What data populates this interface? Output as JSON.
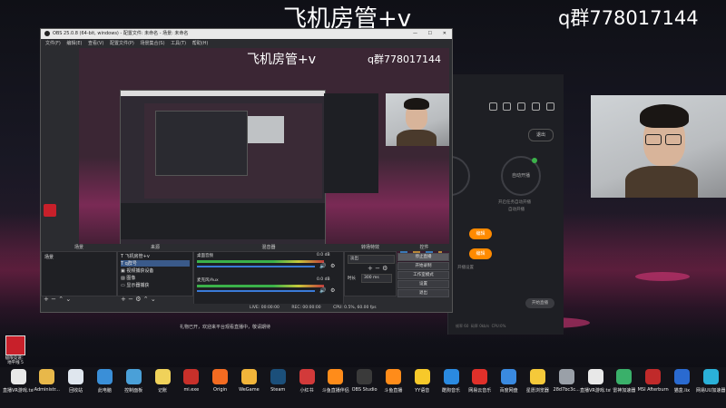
{
  "overlay": {
    "title_text": "飞机房管+v",
    "qq_text": "q群778017144"
  },
  "obs": {
    "window_title": "OBS 25.0.8 (64-bit, windows) - 配置文件: 未命名 - 场景: 未命名",
    "menu": [
      "文件(F)",
      "编辑(E)",
      "查看(V)",
      "配置文件(P)",
      "场景集合(S)",
      "工具(T)",
      "帮助(H)"
    ],
    "docks": {
      "scenes": "场景",
      "sources": "来源",
      "mixer": "混音器",
      "transitions": "转场特效",
      "controls": "控件"
    },
    "scenes": [
      "场景"
    ],
    "sources": [
      "飞机房管+v",
      "q群号",
      "视频捕获设备",
      "图像",
      "显示器捕获"
    ],
    "mixer": {
      "desktop_audio": "桌面音频",
      "desktop_db": "0.0 dB",
      "mic": "麦克风/Aux",
      "mic_db": "0.0 dB"
    },
    "transitions": {
      "type": "淡出",
      "duration_label": "时长",
      "duration_value": "300 ms"
    },
    "controls": [
      "停止直播",
      "开始录制",
      "工作室模式",
      "设置",
      "退出"
    ],
    "status": {
      "drops": "丢帧 0 (0.0%)",
      "live": "LIVE: 00:00:00",
      "rec": "REC: 00:00:00",
      "cpu": "CPU: 0.5%, 60.00 fps"
    },
    "notice": "礼物已开，欢迎来平台观看直播中，敬请期待"
  },
  "side_app": {
    "btn_top": "退出",
    "circle_label": "自动开播",
    "status_text": "开启任务自动开播",
    "status_sub": "自动开播",
    "orange_btn_1": "编辑",
    "orange_btn_2": "编辑",
    "link_text": "开播设置",
    "pill_btn": "开始直播",
    "footer": [
      "丢帧 0 (0.0%)",
      "CPU: 0.5%",
      "帧率 60",
      "码率 0kb/s",
      "CPU:0%",
      "已用 0"
    ]
  },
  "desktop_icon": {
    "label": "极限竞速：地平线 5"
  },
  "taskbar": [
    {
      "label": "直播VR游戏.txt",
      "color": "#e8e8e8"
    },
    {
      "label": "Administr...",
      "color": "#e8b84a"
    },
    {
      "label": "回收站",
      "color": "#dfe6ee"
    },
    {
      "label": "此电脑",
      "color": "#3a8fd8"
    },
    {
      "label": "控制面板",
      "color": "#4aa0d8"
    },
    {
      "label": "记账",
      "color": "#f0d25a"
    },
    {
      "label": "mi.exe",
      "color": "#c8302a"
    },
    {
      "label": "Origin",
      "color": "#f36b21"
    },
    {
      "label": "WeGame",
      "color": "#f2b53a"
    },
    {
      "label": "Steam",
      "color": "#1b4f7a"
    },
    {
      "label": "小红书",
      "color": "#d23a3a"
    },
    {
      "label": "斗鱼直播伴侣",
      "color": "#ff8c1a"
    },
    {
      "label": "OBS Studio",
      "color": "#3a3a3a"
    },
    {
      "label": "斗鱼直播",
      "color": "#ff8c1a"
    },
    {
      "label": "YY语音",
      "color": "#f7c92a"
    },
    {
      "label": "酷狗音乐",
      "color": "#2a8ae0"
    },
    {
      "label": "网易云音乐",
      "color": "#e0302a"
    },
    {
      "label": "百度网盘",
      "color": "#3a8ae0"
    },
    {
      "label": "星愿浏览器",
      "color": "#f5c93a"
    },
    {
      "label": "28d7bc3c...",
      "color": "#9aa0a8"
    },
    {
      "label": "直播VR游戏.txt",
      "color": "#e8e8e8"
    },
    {
      "label": "雷神加速器",
      "color": "#3ab06a"
    },
    {
      "label": "MSI Afterburner",
      "color": "#c02a2a"
    },
    {
      "label": "猫盒.lix",
      "color": "#2a6ad0"
    },
    {
      "label": "网易UU加速器",
      "color": "#2ab0d8"
    }
  ]
}
